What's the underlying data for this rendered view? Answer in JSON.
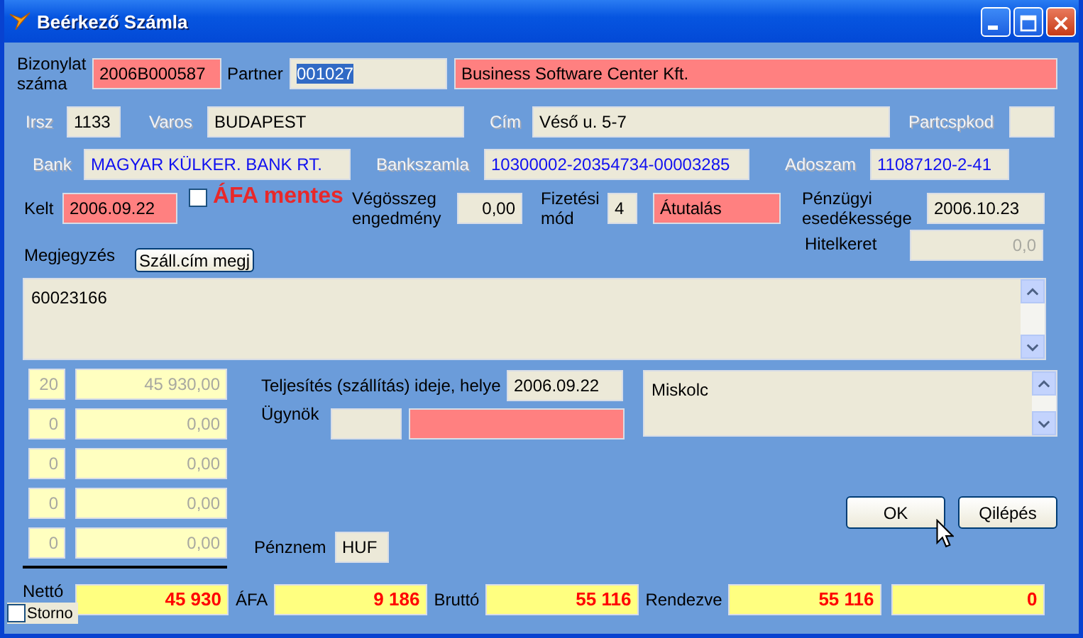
{
  "window": {
    "title": "Beérkező Számla"
  },
  "document": {
    "label": "Bizonylat száma",
    "value": "2006B000587"
  },
  "partner": {
    "label": "Partner",
    "code": "001027",
    "selected": true,
    "name": "Business Software Center Kft."
  },
  "zip": {
    "label": "Irsz",
    "label_disabled": true,
    "value": "1133"
  },
  "city": {
    "label": "Varos",
    "label_disabled": true,
    "value": "BUDAPEST"
  },
  "street": {
    "label": "Cím",
    "label_disabled": true,
    "value": "Véső u. 5-7"
  },
  "partcspkod": {
    "label": "Partcspkod",
    "label_disabled": true
  },
  "bank": {
    "label": "Bank",
    "label_disabled": true,
    "value": "MAGYAR KÜLKER. BANK RT."
  },
  "bank_account": {
    "label": "Bankszamla",
    "label_disabled": true,
    "value": "10300002-20354734-00003285"
  },
  "tax_no": {
    "label": "Adoszam",
    "label_disabled": true,
    "value": "11087120-2-41"
  },
  "issued": {
    "label": "Kelt",
    "value": "2006.09.22"
  },
  "vat_exempt": {
    "label": "ÁFA mentes",
    "checked": false
  },
  "discount": {
    "label": "Végösszeg engedmény",
    "value": "0,00"
  },
  "payment": {
    "label": "Fizetési mód",
    "code": "4",
    "name": "Átutalás"
  },
  "due": {
    "label": "Pénzügyi esedékessége",
    "value": "2006.10.23"
  },
  "credit": {
    "label": "Hitelkeret",
    "value": "0,0",
    "disabled": true
  },
  "note": {
    "label": "Megjegyzés",
    "button": "Száll.cím megj",
    "text": "60023166"
  },
  "vat_lines": [
    {
      "rate": "20",
      "amount": "45 930,00",
      "disabled": true
    },
    {
      "rate": "0",
      "amount": "0,00",
      "disabled": true
    },
    {
      "rate": "0",
      "amount": "0,00",
      "disabled": true
    },
    {
      "rate": "0",
      "amount": "0,00",
      "disabled": true
    },
    {
      "rate": "0",
      "amount": "0,00",
      "disabled": true
    }
  ],
  "delivery": {
    "label": "Teljesítés (szállítás) ideje, helye",
    "date": "2006.09.22",
    "place": "Miskolc"
  },
  "agent": {
    "label": "Ügynök"
  },
  "currency": {
    "label": "Pénznem",
    "value": "HUF"
  },
  "buttons": [
    "OK",
    "Qilépés"
  ],
  "totals": [
    {
      "label": "Nettó",
      "value": "45 930"
    },
    {
      "label": "ÁFA",
      "value": "9 186"
    },
    {
      "label": "Bruttó",
      "value": "55 116"
    },
    {
      "label": "Rendezve",
      "value": "55 116"
    },
    {
      "value": "0"
    }
  ],
  "storno": {
    "label": "Storno",
    "checked": false
  }
}
